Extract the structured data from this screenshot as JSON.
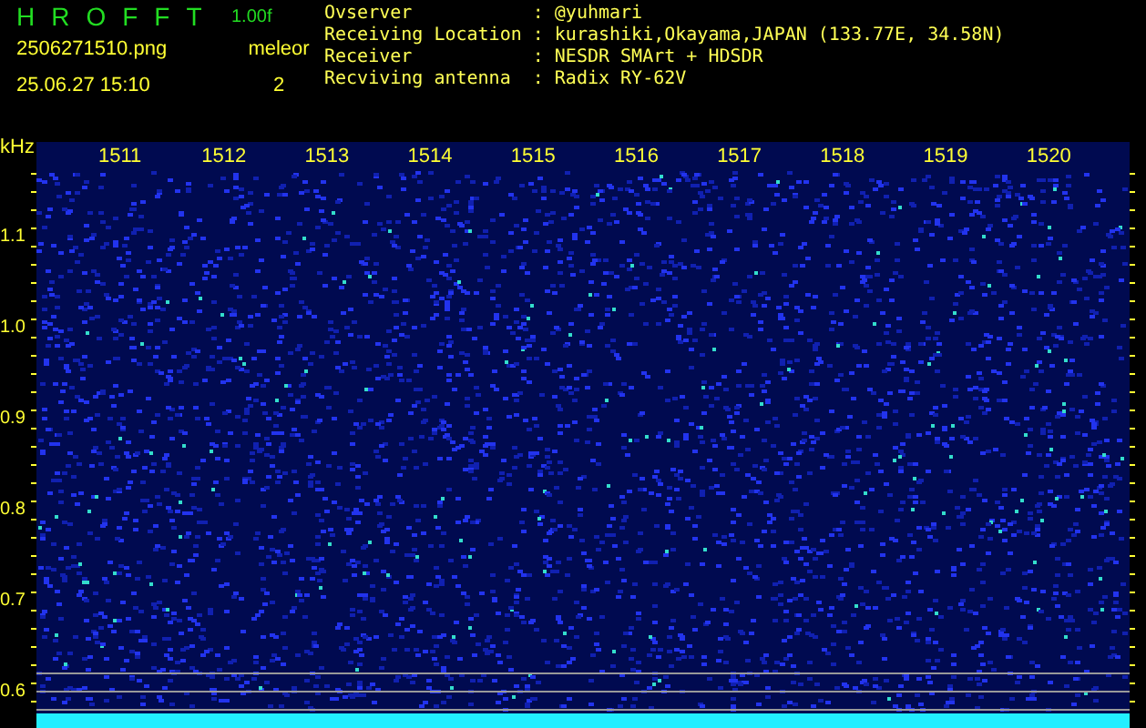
{
  "header": {
    "logo": "HROFFT",
    "version": "1.00f",
    "filename": "2506271510.png",
    "datetime": "25.06.27 15:10",
    "mode_label": "meleor",
    "count": "2"
  },
  "info": [
    {
      "label": "Ovserver",
      "separator": ":",
      "value": "@yuhmari"
    },
    {
      "label": "Receiving Location",
      "separator": ":",
      "value": "kurashiki,Okayama,JAPAN (133.77E, 34.58N)"
    },
    {
      "label": "Receiver",
      "separator": ":",
      "value": "NESDR SMArt + HDSDR"
    },
    {
      "label": "Recviving antenna",
      "separator": ":",
      "value": "Radix RY-62V"
    }
  ],
  "spectrogram": {
    "y_unit": "kHz",
    "y_labels": [
      "1.1",
      "1.0",
      "0.9",
      "0.8",
      "0.7",
      "0.6"
    ],
    "x_labels": [
      "1511",
      "1512",
      "1513",
      "1514",
      "1515",
      "1516",
      "1517",
      "1518",
      "1519",
      "1520"
    ]
  }
}
